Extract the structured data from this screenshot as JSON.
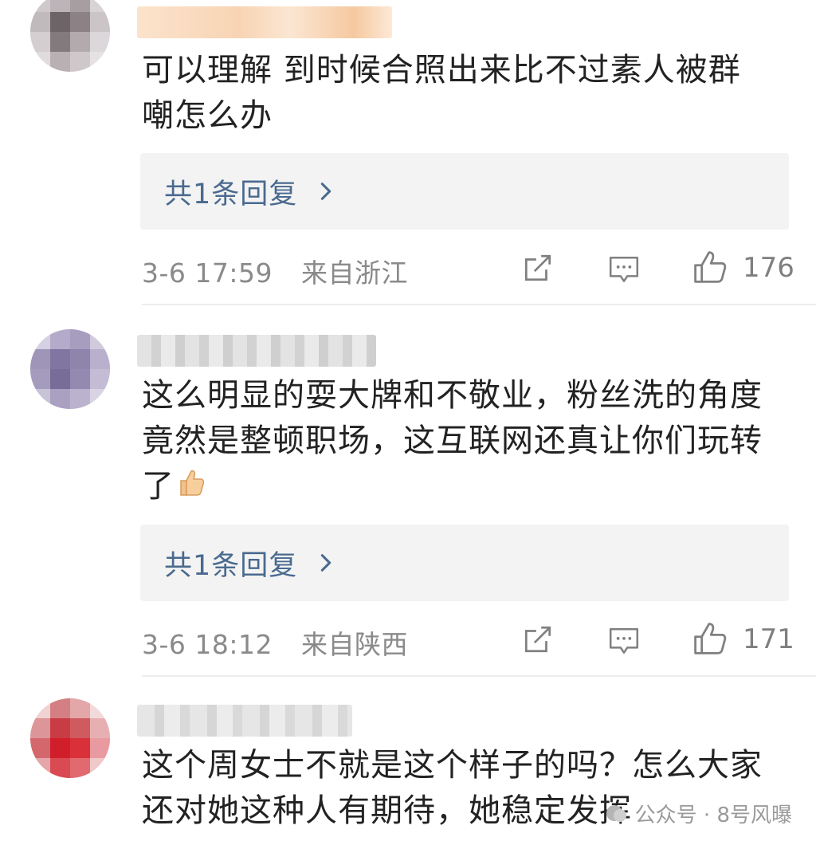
{
  "comments": [
    {
      "text": "可以理解 到时候合照出来比不过素人被群\n嘲怎么办",
      "reply_label": "共1条回复",
      "time": "3-6 17:59",
      "location": "来自浙江",
      "likes": "176"
    },
    {
      "text": "这么明显的耍大牌和不敬业，粉丝洗的角度\n竟然是整顿职场，这互联网还真让你们玩转\n了",
      "reply_label": "共1条回复",
      "time": "3-6 18:12",
      "location": "来自陕西",
      "likes": "171"
    },
    {
      "text": "这个周女士不就是这个样子的吗？怎么大家\n还对她这种人有期待，她稳定发挥"
    }
  ],
  "watermark": {
    "text": "公众号 · 8号风曝"
  },
  "icons": {
    "share": "share-icon",
    "comment": "comment-icon",
    "like": "thumbs-up-icon",
    "chevron": "chevron-right-icon",
    "emoji": "thumbs-up-emoji-icon"
  },
  "colors": {
    "reply_link": "#4a6a8f",
    "reply_bg": "#f3f3f3",
    "meta": "#8a8a8a",
    "text": "#222222"
  }
}
